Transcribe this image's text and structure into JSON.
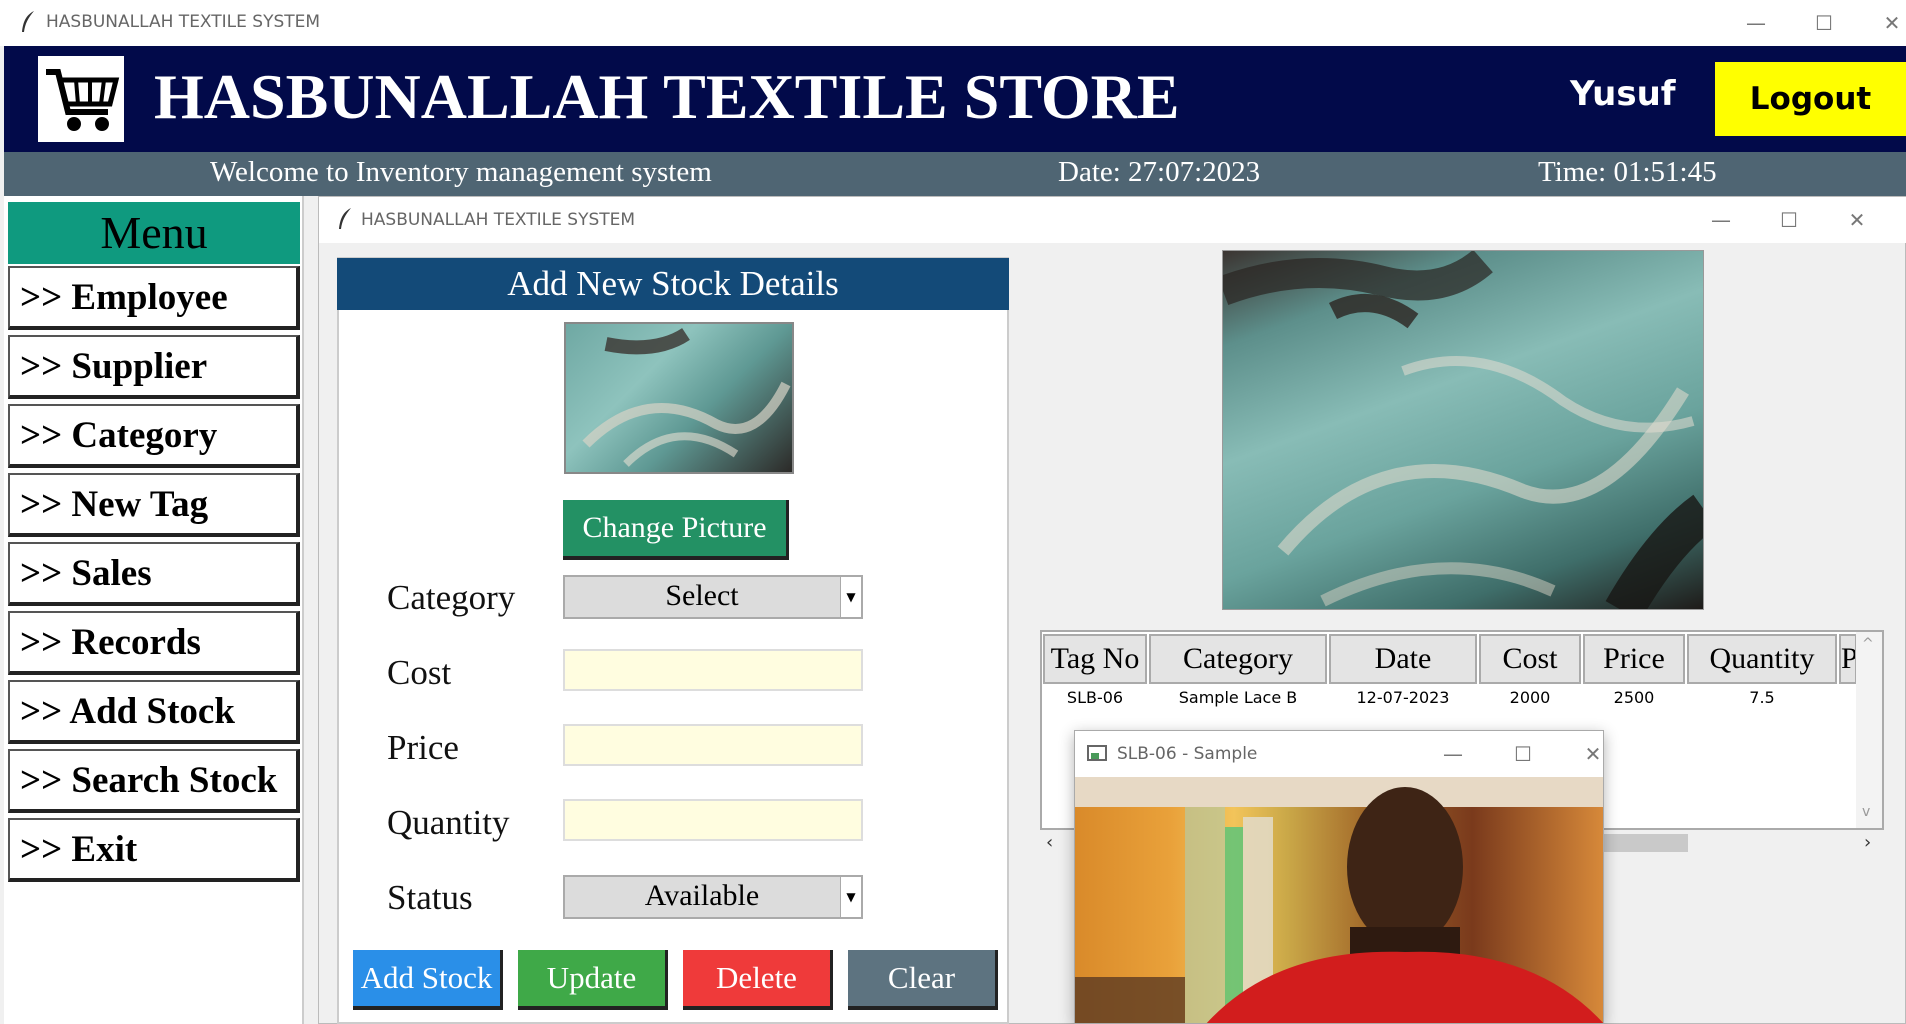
{
  "os_window": {
    "title": "HASBUNALLAH TEXTILE SYSTEM",
    "minimize": "—",
    "maximize": "☐",
    "close": "✕"
  },
  "header": {
    "store_name": "HASBUNALLAH TEXTILE STORE",
    "user": "Yusuf",
    "logout": "Logout",
    "colors": {
      "bg": "#020a4a",
      "logout_bg": "#ffff00"
    }
  },
  "status_bar": {
    "welcome": "Welcome to Inventory management system",
    "date": "Date: 27:07:2023",
    "time": "Time: 01:51:45"
  },
  "menu": {
    "title": "Menu",
    "items": [
      {
        "label": ">> Employee"
      },
      {
        "label": ">> Supplier"
      },
      {
        "label": ">> Category"
      },
      {
        "label": ">> New Tag"
      },
      {
        "label": ">> Sales"
      },
      {
        "label": ">> Records"
      },
      {
        "label": ">> Add Stock"
      },
      {
        "label": ">> Search Stock"
      },
      {
        "label": ">> Exit"
      }
    ]
  },
  "child_window": {
    "title": "HASBUNALLAH TEXTILE SYSTEM"
  },
  "form": {
    "title": "Add New Stock Details",
    "change_picture": "Change Picture",
    "category_label": "Category",
    "category_value": "Select",
    "cost_label": "Cost",
    "cost_value": "",
    "price_label": "Price",
    "price_value": "",
    "quantity_label": "Quantity",
    "quantity_value": "",
    "status_label": "Status",
    "status_value": "Available",
    "buttons": {
      "add": "Add Stock",
      "update": "Update",
      "delete": "Delete",
      "clear": "Clear"
    }
  },
  "table": {
    "columns": [
      "Tag No",
      "Category",
      "Date",
      "Cost",
      "Price",
      "Quantity",
      "P"
    ],
    "rows": [
      {
        "tag": "SLB-06",
        "category": "Sample Lace B",
        "date": "12-07-2023",
        "cost": "2000",
        "price": "2500",
        "quantity": "7.5"
      }
    ]
  },
  "popup": {
    "title": "SLB-06 - Sample"
  }
}
